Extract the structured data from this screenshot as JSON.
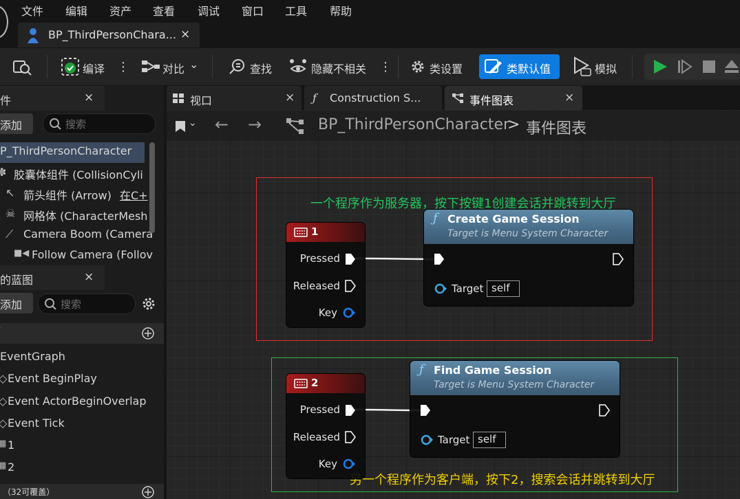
{
  "menu": {
    "items": [
      "文件",
      "编辑",
      "资产",
      "查看",
      "调试",
      "窗口",
      "工具",
      "帮助"
    ]
  },
  "doc_tab": {
    "title": "BP_ThirdPersonChara...",
    "close": "×"
  },
  "toolbar": {
    "compile": "编译",
    "diff": "对比",
    "find": "查找",
    "hide_unrelated": "隐藏不相关",
    "class_settings": "类设置",
    "class_defaults": "类默认值",
    "simulate": "模拟",
    "accent": "#0e7be0"
  },
  "components_panel": {
    "title": "件",
    "close": "×",
    "add": "添加",
    "search_placeholder": "搜索",
    "tree": [
      "P_ThirdPersonCharacter",
      "胶囊体组件 (CollisionCyli",
      "箭头组件 (Arrow)",
      "网格体 (CharacterMesh",
      "Camera Boom (Camera",
      "Follow Camera (Follov"
    ],
    "arrow_suffix": "在C+"
  },
  "my_blueprint_panel": {
    "title": "的蓝图",
    "close": "×",
    "add": "添加",
    "search_placeholder": "搜索",
    "graphs": [
      "EventGraph",
      "Event BeginPlay",
      "Event ActorBeginOverlap",
      "Event Tick",
      "1",
      "2"
    ],
    "footer": "32可覆盖"
  },
  "graph_tabs": [
    {
      "label": "视口",
      "close": "×"
    },
    {
      "label": "Construction S...",
      "close": ""
    },
    {
      "label": "事件图表",
      "close": "×"
    }
  ],
  "breadcrumb": {
    "root": "BP_ThirdPersonCharacter",
    "sep": ">",
    "current": "事件图表"
  },
  "comments": [
    {
      "text": "一个程序作为服务器，按下按键1创建会话并跳转到大厅",
      "color": "#e0302f",
      "text_color": "#22c55e"
    },
    {
      "text": "另一个程序作为客户端，按下2，搜索会话并跳转到大厅",
      "color": "#2fb84a",
      "text_color": "#f0d000"
    }
  ],
  "key_nodes": [
    {
      "key": "1",
      "pins": {
        "pressed": "Pressed",
        "released": "Released",
        "key": "Key"
      }
    },
    {
      "key": "2",
      "pins": {
        "pressed": "Pressed",
        "released": "Released",
        "key": "Key"
      }
    }
  ],
  "function_nodes": [
    {
      "title": "Create Game Session",
      "subtitle": "Target is Menu System Character",
      "target_label": "Target",
      "target_value": "self"
    },
    {
      "title": "Find Game Session",
      "subtitle": "Target is Menu System Character",
      "target_label": "Target",
      "target_value": "self"
    }
  ]
}
